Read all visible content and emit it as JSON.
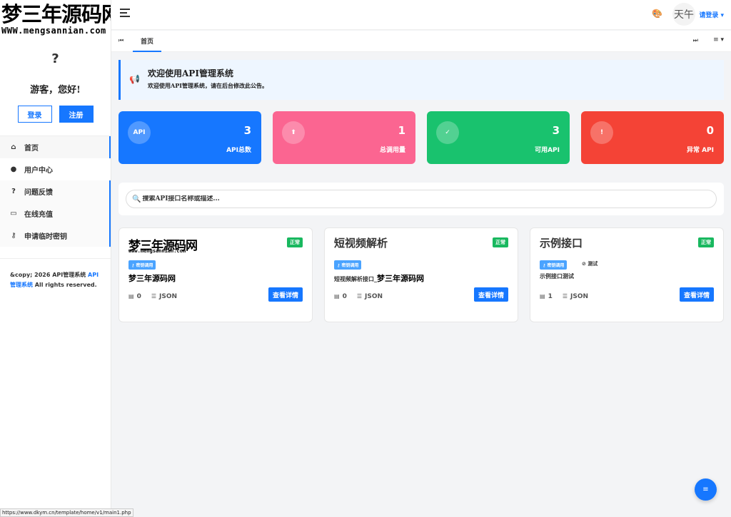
{
  "sidebar": {
    "logo_main": "梦三年源码网",
    "logo_sub": "WWW.mengsannian.com",
    "avatar_placeholder": "?",
    "greeting": "游客，您好!",
    "login_label": "登录",
    "register_label": "注册",
    "items": [
      {
        "label": "首页",
        "icon": "home-icon",
        "glyph": "⌂"
      },
      {
        "label": "用户中心",
        "icon": "user-circle-icon",
        "glyph": "●"
      },
      {
        "label": "问题反馈",
        "icon": "feedback-icon",
        "glyph": "?"
      },
      {
        "label": "在线充值",
        "icon": "credit-card-icon",
        "glyph": "▭"
      },
      {
        "label": "申请临时密钥",
        "icon": "key-icon",
        "glyph": "⚷"
      }
    ],
    "copyright_prefix": "&copy; 2026 API管理系统 ",
    "copyright_link": "API管理系统",
    "copyright_suffix": " All rights reserved."
  },
  "topbar": {
    "user_avatar_text": "天午",
    "login_link": "请登录"
  },
  "tabs": {
    "home_label": "首页"
  },
  "notice": {
    "title": "欢迎使用API管理系统",
    "text": "欢迎使用API管理系统，请在后台修改此公告。"
  },
  "stats": [
    {
      "icon_text": "API",
      "value": "3",
      "label": "API总数",
      "color": "#1677ff"
    },
    {
      "icon_text": "⬆",
      "value": "1",
      "label": "总调用量",
      "color": "#fb6591"
    },
    {
      "icon_text": "✓",
      "value": "3",
      "label": "可用API",
      "color": "#19c26e"
    },
    {
      "icon_text": "!",
      "value": "0",
      "label": "异常 API",
      "color": "#f44336"
    }
  ],
  "search": {
    "placeholder": "搜索API接口名称或描述..."
  },
  "cards": [
    {
      "logo_main": "梦三年源码网",
      "logo_sub": "www.mengsannian.com",
      "status": "正常",
      "tag": "⚷ 密钥调用",
      "desc_logo": "梦三年源码网",
      "calls": "0",
      "format": "JSON",
      "button": "查看详情"
    },
    {
      "title": "短视频解析",
      "status": "正常",
      "tag": "⚷ 密钥调用",
      "desc": "短视频解析接口_",
      "desc_logo": "梦三年源码网",
      "calls": "0",
      "format": "JSON",
      "button": "查看详情"
    },
    {
      "title": "示例接口",
      "status": "正常",
      "tag": "⚷ 密钥调用",
      "tag2": "测试",
      "desc": "示例接口测试",
      "calls": "1",
      "format": "JSON",
      "button": "查看详情"
    }
  ],
  "statusbar_url": "https://www.dkym.cn/template/home/v1/main1.php"
}
